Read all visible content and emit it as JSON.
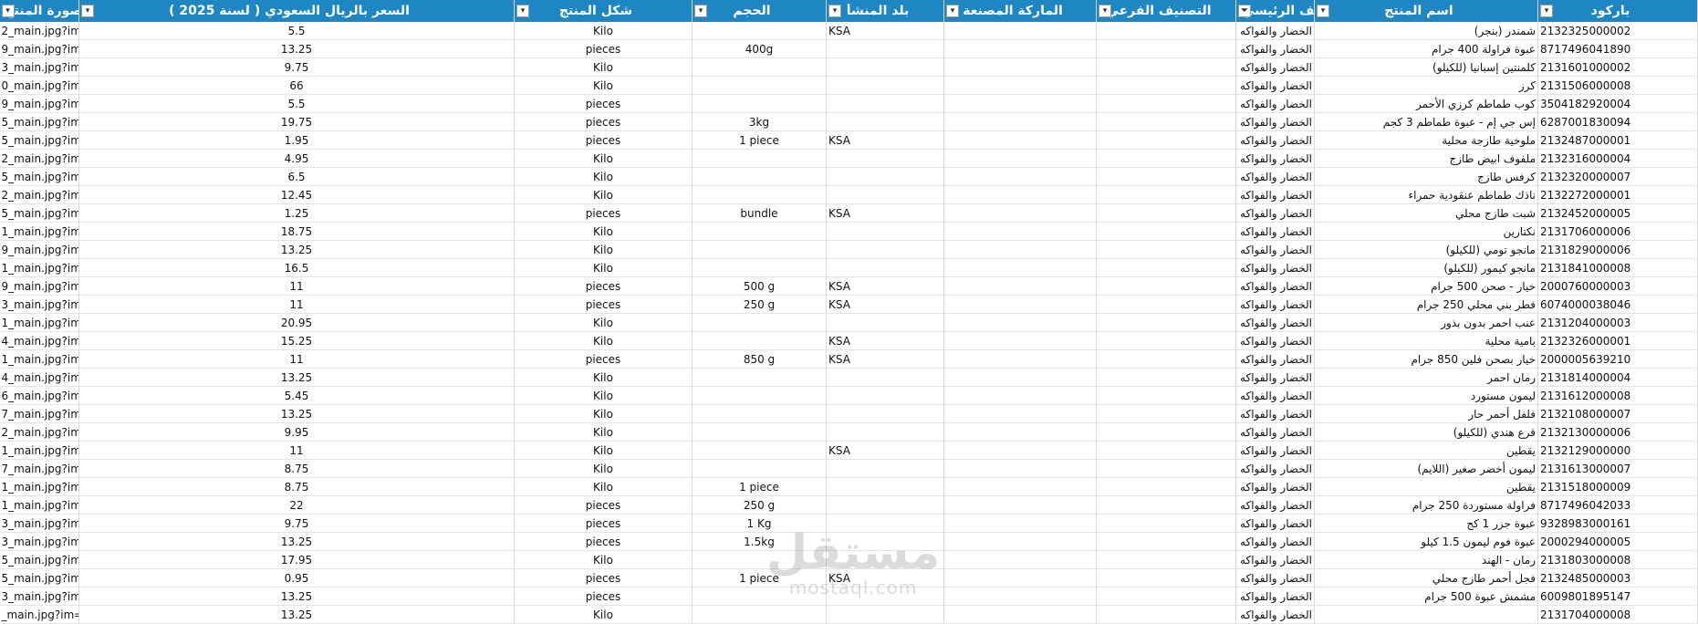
{
  "columns": [
    {
      "key": "barcode",
      "label": "باركود"
    },
    {
      "key": "name",
      "label": "اسم المنتج"
    },
    {
      "key": "main_cat",
      "label": "التصنيف الرئيسي"
    },
    {
      "key": "sub_cat",
      "label": "التصنيف الفرعي"
    },
    {
      "key": "brand",
      "label": "الماركة المصنعة"
    },
    {
      "key": "origin",
      "label": "بلد المنشأ"
    },
    {
      "key": "size",
      "label": "الحجم"
    },
    {
      "key": "form",
      "label": "شكل المنتج"
    },
    {
      "key": "price",
      "label": "السعر بالريال السعودي ( لسنة 2025 )"
    },
    {
      "key": "link",
      "label": "رابط صورة المنتج"
    }
  ],
  "rows": [
    {
      "barcode": "2132325000002",
      "name": "شمندر (بنجر)",
      "main_cat": "الخضار والفواكه",
      "sub_cat": "",
      "brand": "",
      "origin": "KSA",
      "size": "",
      "form": "Kilo",
      "price": "5.5",
      "link": "2_main.jpg?im=Resize=1700"
    },
    {
      "barcode": "8717496041890",
      "name": "عبوة فراولة 400 جرام",
      "main_cat": "الخضار والفواكه",
      "sub_cat": "",
      "brand": "",
      "origin": "",
      "size": "400g",
      "form": "pieces",
      "price": "13.25",
      "link": "9_main.jpg?im=Resize=1700"
    },
    {
      "barcode": "2131601000002",
      "name": "كلمنتين إسبانيا (للكيلو)",
      "main_cat": "الخضار والفواكه",
      "sub_cat": "",
      "brand": "",
      "origin": "",
      "size": "",
      "form": "Kilo",
      "price": "9.75",
      "link": "3_main.jpg?im=Resize=1700"
    },
    {
      "barcode": "2131506000008",
      "name": "كرز",
      "main_cat": "الخضار والفواكه",
      "sub_cat": "",
      "brand": "",
      "origin": "",
      "size": "",
      "form": "Kilo",
      "price": "66",
      "link": "0_main.jpg?im=Resize=1700"
    },
    {
      "barcode": "3504182920004",
      "name": "كوب طماطم كرزي الأحمر",
      "main_cat": "الخضار والفواكه",
      "sub_cat": "",
      "brand": "",
      "origin": "",
      "size": "",
      "form": "pieces",
      "price": "5.5",
      "link": "9_main.jpg?im=Resize=1700"
    },
    {
      "barcode": "6287001830094",
      "name": "إس جي إم - عبوة طماطم 3 كجم",
      "main_cat": "الخضار والفواكه",
      "sub_cat": "",
      "brand": "",
      "origin": "",
      "size": "3kg",
      "form": "pieces",
      "price": "19.75",
      "link": "5_main.jpg?im=Resize=1700"
    },
    {
      "barcode": "2132487000001",
      "name": "ملوخية طازجة محلية",
      "main_cat": "الخضار والفواكه",
      "sub_cat": "",
      "brand": "",
      "origin": "KSA",
      "size": "1 piece",
      "form": "pieces",
      "price": "1.95",
      "link": "5_main.jpg?im=Resize=1700"
    },
    {
      "barcode": "2132316000004",
      "name": "ملفوف ابيض طازج",
      "main_cat": "الخضار والفواكه",
      "sub_cat": "",
      "brand": "",
      "origin": "",
      "size": "",
      "form": "Kilo",
      "price": "4.95",
      "link": "2_main.jpg?im=Resize=1700"
    },
    {
      "barcode": "2132320000007",
      "name": "كرفس طازج",
      "main_cat": "الخضار والفواكه",
      "sub_cat": "",
      "brand": "",
      "origin": "",
      "size": "",
      "form": "Kilo",
      "price": "6.5",
      "link": "5_main.jpg?im=Resize=1700"
    },
    {
      "barcode": "2132272000001",
      "name": "ناذك طماطم عنقودية حمراء",
      "main_cat": "الخضار والفواكه",
      "sub_cat": "",
      "brand": "",
      "origin": "",
      "size": "",
      "form": "Kilo",
      "price": "12.45",
      "link": "2_main.jpg?im=Resize=1700"
    },
    {
      "barcode": "2132452000005",
      "name": "شبت طازج محلي",
      "main_cat": "الخضار والفواكه",
      "sub_cat": "",
      "brand": "",
      "origin": "KSA",
      "size": "bundle",
      "form": "pieces",
      "price": "1.25",
      "link": "5_main.jpg?im=Resize=1700"
    },
    {
      "barcode": "2131706000006",
      "name": "نكتارين",
      "main_cat": "الخضار والفواكه",
      "sub_cat": "",
      "brand": "",
      "origin": "",
      "size": "",
      "form": "Kilo",
      "price": "18.75",
      "link": "1_main.jpg?im=Resize=1700"
    },
    {
      "barcode": "2131829000006",
      "name": "مانجو تومي (للكيلو)",
      "main_cat": "الخضار والفواكه",
      "sub_cat": "",
      "brand": "",
      "origin": "",
      "size": "",
      "form": "Kilo",
      "price": "13.25",
      "link": "9_main.jpg?im=Resize=1700"
    },
    {
      "barcode": "2131841000008",
      "name": "مانجو كيمور (للكيلو)",
      "main_cat": "الخضار والفواكه",
      "sub_cat": "",
      "brand": "",
      "origin": "",
      "size": "",
      "form": "Kilo",
      "price": "16.5",
      "link": "1_main.jpg?im=Resize=1700"
    },
    {
      "barcode": "2000760000003",
      "name": "خيار - صحن 500 جرام",
      "main_cat": "الخضار والفواكه",
      "sub_cat": "",
      "brand": "",
      "origin": "KSA",
      "size": "500 g",
      "form": "pieces",
      "price": "11",
      "link": "9_main.jpg?im=Resize=1700"
    },
    {
      "barcode": "6074000038046",
      "name": "فطر بني محلي 250 جرام",
      "main_cat": "الخضار والفواكه",
      "sub_cat": "",
      "brand": "",
      "origin": "KSA",
      "size": "250 g",
      "form": "pieces",
      "price": "11",
      "link": "3_main.jpg?im=Resize=1700"
    },
    {
      "barcode": "2131204000003",
      "name": "عنب احمر بدون بذور",
      "main_cat": "الخضار والفواكه",
      "sub_cat": "",
      "brand": "",
      "origin": "",
      "size": "",
      "form": "Kilo",
      "price": "20.95",
      "link": "1_main.jpg?im=Resize=1700"
    },
    {
      "barcode": "2132326000001",
      "name": "بامية محلية",
      "main_cat": "الخضار والفواكه",
      "sub_cat": "",
      "brand": "",
      "origin": "KSA",
      "size": "",
      "form": "Kilo",
      "price": "15.25",
      "link": "4_main.jpg?im=Resize=1700"
    },
    {
      "barcode": "2000005639210",
      "name": "خيار بصحن فلين 850 جرام",
      "main_cat": "الخضار والفواكه",
      "sub_cat": "",
      "brand": "",
      "origin": "KSA",
      "size": "850 g",
      "form": "pieces",
      "price": "11",
      "link": "1_main.jpg?im=Resize=1700"
    },
    {
      "barcode": "2131814000004",
      "name": "رمان احمر",
      "main_cat": "الخضار والفواكه",
      "sub_cat": "",
      "brand": "",
      "origin": "",
      "size": "",
      "form": "Kilo",
      "price": "13.25",
      "link": "4_main.jpg?im=Resize=1700"
    },
    {
      "barcode": "2131612000008",
      "name": "ليمون مستورد",
      "main_cat": "الخضار والفواكه",
      "sub_cat": "",
      "brand": "",
      "origin": "",
      "size": "",
      "form": "Kilo",
      "price": "5.45",
      "link": "6_main.jpg?im=Resize=1700"
    },
    {
      "barcode": "2132108000007",
      "name": "فلفل أحمر حار",
      "main_cat": "الخضار والفواكه",
      "sub_cat": "",
      "brand": "",
      "origin": "",
      "size": "",
      "form": "Kilo",
      "price": "13.25",
      "link": "7_main.jpg?im=Resize=1700"
    },
    {
      "barcode": "2132130000006",
      "name": "قرع هندي (للكيلو)",
      "main_cat": "الخضار والفواكه",
      "sub_cat": "",
      "brand": "",
      "origin": "",
      "size": "",
      "form": "Kilo",
      "price": "9.95",
      "link": "2_main.jpg?im=Resize=1700"
    },
    {
      "barcode": "2132129000000",
      "name": "يقطين",
      "main_cat": "الخضار والفواكه",
      "sub_cat": "",
      "brand": "",
      "origin": "KSA",
      "size": "",
      "form": "Kilo",
      "price": "11",
      "link": "1_main.jpg?im=Resize=1700"
    },
    {
      "barcode": "2131613000007",
      "name": "ليمون أخضر صغير (اللايم)",
      "main_cat": "الخضار والفواكه",
      "sub_cat": "",
      "brand": "",
      "origin": "",
      "size": "",
      "form": "Kilo",
      "price": "8.75",
      "link": "7_main.jpg?im=Resize=1700"
    },
    {
      "barcode": "2131518000009",
      "name": "يقطين",
      "main_cat": "الخضار والفواكه",
      "sub_cat": "",
      "brand": "",
      "origin": "",
      "size": "1 piece",
      "form": "Kilo",
      "price": "8.75",
      "link": "1_main.jpg?im=Resize=1700"
    },
    {
      "barcode": "8717496042033",
      "name": "فراولة مستوردة 250 جرام",
      "main_cat": "الخضار والفواكه",
      "sub_cat": "",
      "brand": "",
      "origin": "",
      "size": "250 g",
      "form": "pieces",
      "price": "22",
      "link": "1_main.jpg?im=Resize=1700"
    },
    {
      "barcode": "9328983000161",
      "name": "عبوة جزر 1 كج",
      "main_cat": "الخضار والفواكه",
      "sub_cat": "",
      "brand": "",
      "origin": "",
      "size": "1 Kg",
      "form": "pieces",
      "price": "9.75",
      "link": "3_main.jpg?im=Resize=1700"
    },
    {
      "barcode": "2000294000005",
      "name": "عبوة فوم ليمون 1.5 كيلو",
      "main_cat": "الخضار والفواكه",
      "sub_cat": "",
      "brand": "",
      "origin": "",
      "size": "1.5kg",
      "form": "pieces",
      "price": "13.25",
      "link": "3_main.jpg?im=Resize=1700"
    },
    {
      "barcode": "2131803000008",
      "name": "رمان - الهند",
      "main_cat": "الخضار والفواكه",
      "sub_cat": "",
      "brand": "",
      "origin": "",
      "size": "",
      "form": "Kilo",
      "price": "17.95",
      "link": "5_main.jpg?im=Resize=1700"
    },
    {
      "barcode": "2132485000003",
      "name": "فجل أحمر طازج محلي",
      "main_cat": "الخضار والفواكه",
      "sub_cat": "",
      "brand": "",
      "origin": "KSA",
      "size": "1 piece",
      "form": "pieces",
      "price": "0.95",
      "link": "5_main.jpg?im=Resize=1700"
    },
    {
      "barcode": "6009801895147",
      "name": "مشمش عبوة 500 جرام",
      "main_cat": "الخضار والفواكه",
      "sub_cat": "",
      "brand": "",
      "origin": "",
      "size": "",
      "form": "pieces",
      "price": "13.25",
      "link": "3_main.jpg?im=Resize=1700"
    },
    {
      "barcode": "2131704000008",
      "name": "",
      "main_cat": "الخضار والفواكه",
      "sub_cat": "",
      "brand": "",
      "origin": "",
      "size": "",
      "form": "Kilo",
      "price": "13.25",
      "link": "_main.jpg?im=Resize=1700"
    }
  ],
  "watermark": {
    "arabic": "مستقل",
    "latin": "mostaql.com"
  },
  "colors": {
    "header_bg": "#1f86c4",
    "header_text": "#ffffff"
  },
  "icons": {
    "filter": "dropdown-arrow-icon",
    "active_filter": "filter-funnel-icon"
  }
}
